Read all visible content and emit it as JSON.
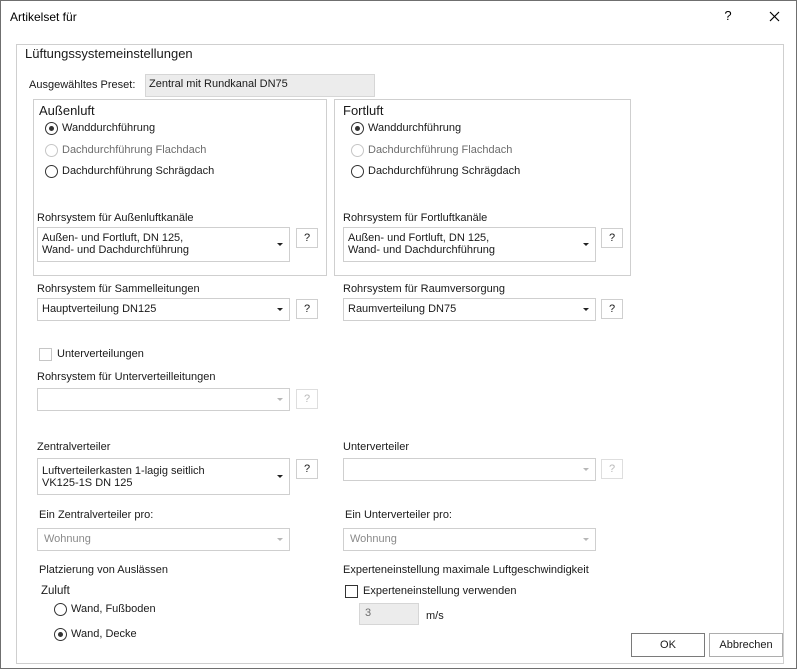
{
  "window": {
    "title": "Artikelset für",
    "help_glyph": "?"
  },
  "group": {
    "title": "Lüftungssystemeinstellungen"
  },
  "preset": {
    "label": "Ausgewähltes Preset:",
    "value": "Zentral mit Rundkanal DN75"
  },
  "aussenluft": {
    "title": "Außenluft",
    "options": [
      {
        "label": "Wanddurchführung",
        "selected": true,
        "enabled": true
      },
      {
        "label": "Dachdurchführung Flachdach",
        "selected": false,
        "enabled": false
      },
      {
        "label": "Dachdurchführung Schrägdach",
        "selected": false,
        "enabled": true
      }
    ],
    "pipe_label": "Rohrsystem für Außenluftkanäle",
    "pipe_value": "Außen- und Fortluft, DN 125,\nWand- und Dachdurchführung"
  },
  "fortluft": {
    "title": "Fortluft",
    "options": [
      {
        "label": "Wanddurchführung",
        "selected": true,
        "enabled": true
      },
      {
        "label": "Dachdurchführung Flachdach",
        "selected": false,
        "enabled": false
      },
      {
        "label": "Dachdurchführung Schrägdach",
        "selected": false,
        "enabled": true
      }
    ],
    "pipe_label": "Rohrsystem für Fortluftkanäle",
    "pipe_value": "Außen- und Fortluft, DN 125,\nWand- und Dachdurchführung"
  },
  "sammel": {
    "label": "Rohrsystem für Sammelleitungen",
    "value": "Hauptverteilung DN125"
  },
  "raum": {
    "label": "Rohrsystem für Raumversorgung",
    "value": "Raumverteilung DN75"
  },
  "unterverteilungen": {
    "checkbox_label": "Unterverteilungen",
    "checked": false,
    "pipe_label": "Rohrsystem für Unterverteilleitungen",
    "pipe_value": ""
  },
  "zentralverteiler": {
    "label": "Zentralverteiler",
    "value": "Luftverteilerkasten 1-lagig seitlich\nVK125-1S DN 125"
  },
  "unterverteiler": {
    "label": "Unterverteiler",
    "value": ""
  },
  "zentral_pro": {
    "label": "Ein Zentralverteiler pro:",
    "value": "Wohnung"
  },
  "unter_pro": {
    "label": "Ein Unterverteiler pro:",
    "value": "Wohnung"
  },
  "auslaesse": {
    "label": "Platzierung von Auslässen",
    "zuluft_label": "Zuluft",
    "options": [
      {
        "label": "Wand, Fußboden",
        "selected": false
      },
      {
        "label": "Wand, Decke",
        "selected": true
      }
    ]
  },
  "experte": {
    "label": "Experteneinstellung maximale Luftgeschwindigkeit",
    "checkbox_label": "Experteneinstellung verwenden",
    "checked": false,
    "value": "3",
    "unit": "m/s"
  },
  "buttons": {
    "help": "?",
    "ok": "OK",
    "cancel": "Abbrechen"
  }
}
